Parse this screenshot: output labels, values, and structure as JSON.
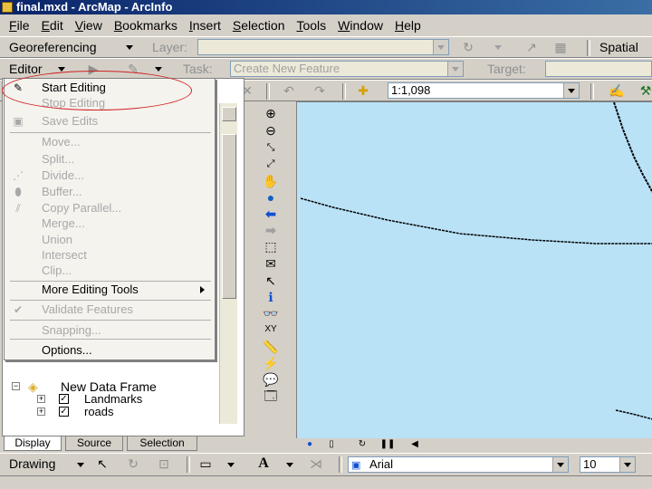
{
  "window": {
    "title": "final.mxd - ArcMap - ArcInfo"
  },
  "menubar": [
    "File",
    "Edit",
    "View",
    "Bookmarks",
    "Insert",
    "Selection",
    "Tools",
    "Window",
    "Help"
  ],
  "georef_toolbar": {
    "label": "Georeferencing",
    "layer_label": "Layer:",
    "layer_value": "",
    "spatial_label": "Spatial"
  },
  "editor_toolbar": {
    "label": "Editor",
    "task_label": "Task:",
    "task_value": "Create New Feature",
    "target_label": "Target:",
    "target_value": ""
  },
  "standard_toolbar": {
    "scale_value": "1:1,098"
  },
  "editor_menu": {
    "start_editing": "Start Editing",
    "stop_editing": "Stop Editing",
    "save_edits": "Save Edits",
    "move": "Move...",
    "split": "Split...",
    "divide": "Divide...",
    "buffer": "Buffer...",
    "copy_parallel": "Copy Parallel...",
    "merge": "Merge...",
    "union": "Union",
    "intersect": "Intersect",
    "clip": "Clip...",
    "more_tools": "More Editing Tools",
    "validate": "Validate Features",
    "snapping": "Snapping...",
    "options": "Options..."
  },
  "toc": {
    "data_frame": "New Data Frame",
    "layers": [
      {
        "name": "Landmarks",
        "checked": true
      },
      {
        "name": "roads",
        "checked": true
      }
    ],
    "tabs": [
      "Display",
      "Source",
      "Selection"
    ],
    "active_tab": "Display"
  },
  "drawing_toolbar": {
    "label": "Drawing",
    "text_tool": "A",
    "font_value": "Arial",
    "font_size": "10"
  }
}
